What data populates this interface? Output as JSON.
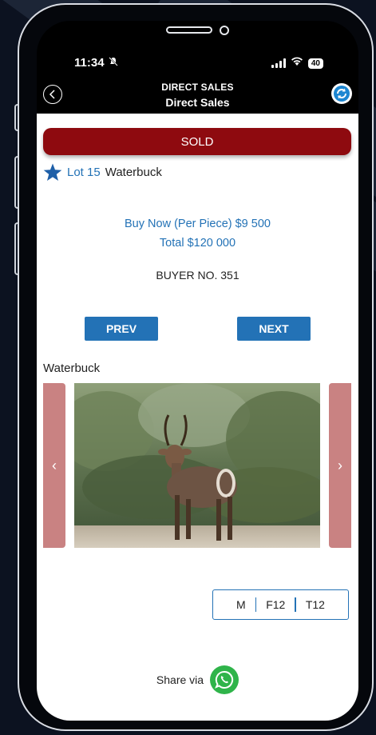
{
  "status_bar": {
    "time": "11:34",
    "battery": "40"
  },
  "nav": {
    "title": "DIRECT SALES",
    "subtitle": "Direct Sales"
  },
  "sale": {
    "status": "SOLD",
    "lot_label": "Lot 15",
    "lot_name": "Waterbuck",
    "buy_now": "Buy Now (Per Piece) $9 500",
    "total": "Total $120 000",
    "buyer": "BUYER NO. 351"
  },
  "buttons": {
    "prev": "PREV",
    "next": "NEXT"
  },
  "gallery": {
    "title": "Waterbuck",
    "prev_glyph": "‹",
    "next_glyph": "›"
  },
  "sizes": {
    "m": "M",
    "f": "F12",
    "t": "T12"
  },
  "share": {
    "label": "Share via"
  },
  "colors": {
    "sold": "#8e0a0f",
    "accent": "#2372b6",
    "carousel_arrow": "#c98282",
    "whatsapp": "#2fb44a"
  },
  "icons": [
    "back-icon",
    "refresh-icon",
    "star-icon",
    "bell-muted-icon",
    "signal-icon",
    "wifi-icon",
    "battery-icon",
    "whatsapp-icon"
  ]
}
